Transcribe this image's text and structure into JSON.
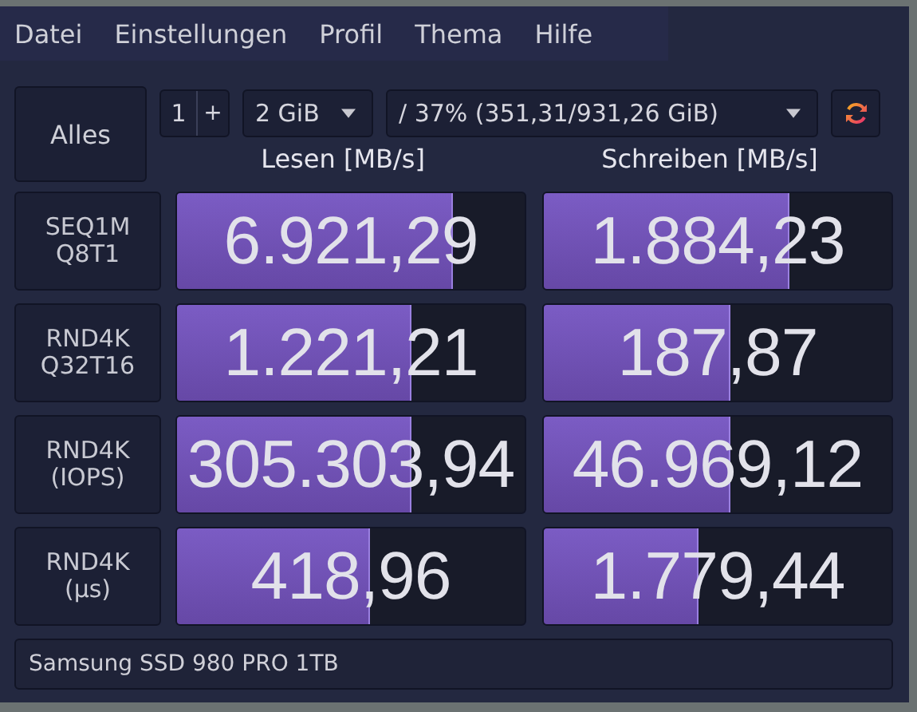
{
  "menu": [
    "Datei",
    "Einstellungen",
    "Profil",
    "Thema",
    "Hilfe"
  ],
  "toolbar": {
    "all_button": "Alles",
    "count": "1",
    "count_step": "+",
    "size": "2 GiB",
    "drive": "/ 37% (351,31/931,26 GiB)"
  },
  "headers": {
    "read": "Lesen [MB/s]",
    "write": "Schreiben [MB/s]"
  },
  "rows": [
    {
      "label": "SEQ1M\nQ8T1",
      "read": {
        "value": "6.921,29",
        "level": 0.79
      },
      "write": {
        "value": "1.884,23",
        "level": 0.7
      }
    },
    {
      "label": "RND4K\nQ32T16",
      "read": {
        "value": "1.221,21",
        "level": 0.67
      },
      "write": {
        "value": "187,87",
        "level": 0.53
      }
    },
    {
      "label": "RND4K\n(IOPS)",
      "read": {
        "value": "305.303,94",
        "level": 0.67
      },
      "write": {
        "value": "46.969,12",
        "level": 0.53
      }
    },
    {
      "label": "RND4K\n(µs)",
      "read": {
        "value": "418,96",
        "level": 0.55
      },
      "write": {
        "value": "1.779,44",
        "level": 0.44
      }
    }
  ],
  "status_bar": "Samsung SSD 980 PRO 1TB"
}
